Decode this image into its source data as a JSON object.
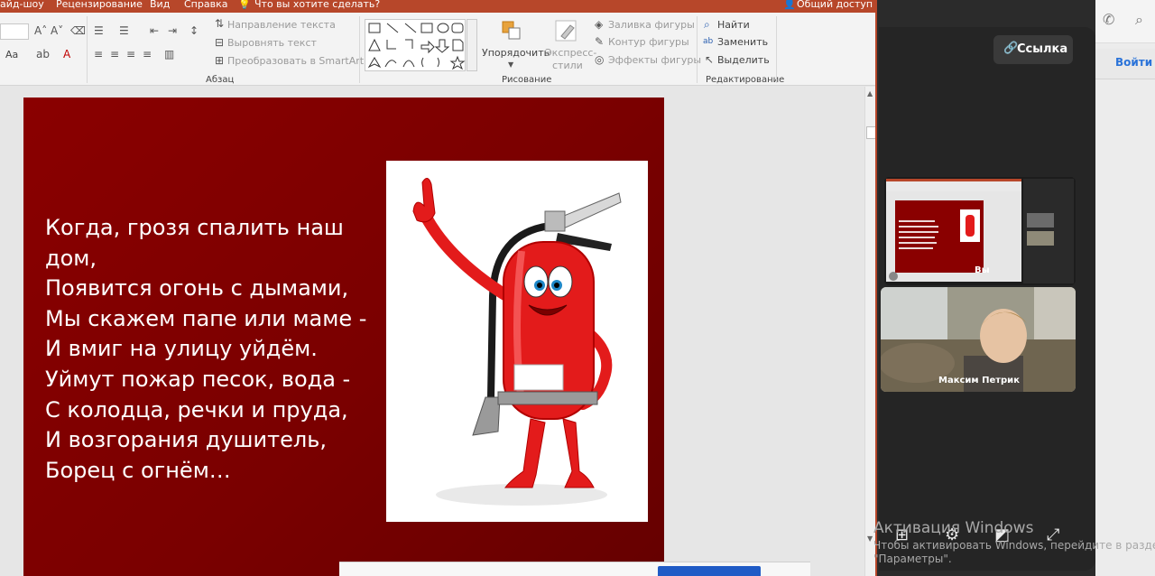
{
  "ppt": {
    "menu": [
      "айд-шоу",
      "Рецензирование",
      "Вид",
      "Справка",
      "Что вы хотите сделать?",
      "Общий доступ"
    ],
    "ribbon": {
      "text_direction": "Направление текста",
      "align_text": "Выровнять текст",
      "convert_smartart": "Преобразовать в SmartArt",
      "paragraph_group": "Абзац",
      "arrange": "Упорядочить",
      "quick_styles_1": "Экспресс-",
      "quick_styles_2": "стили",
      "shape_fill": "Заливка фигуры",
      "shape_outline": "Контур фигуры",
      "shape_effects": "Эффекты фигуры",
      "drawing_group": "Рисование",
      "find": "Найти",
      "replace": "Заменить",
      "select": "Выделить",
      "editing_group": "Редактирование",
      "font_size_label": "Aa"
    },
    "slide": {
      "poem_lines": [
        "Когда, грозя спалить наш",
        "дом,",
        "Появится огонь с дымами,",
        "Мы скажем папе или маме -",
        "И вмиг на улицу уйдём.",
        "Уймут пожар песок, вода -",
        "С колодца, речки и пруда,",
        "И возгорания душитель,",
        "Борец с огнём…"
      ]
    }
  },
  "call": {
    "link_label": "Ссылка",
    "self_label": "Вы",
    "participant_name": "Максим Петрик"
  },
  "side": {
    "login_label": "Войти"
  },
  "watermark": {
    "title": "Активация Windows",
    "line1": "Чтобы активировать Windows, перейдите в раздел",
    "line2": "\"Параметры\"."
  }
}
